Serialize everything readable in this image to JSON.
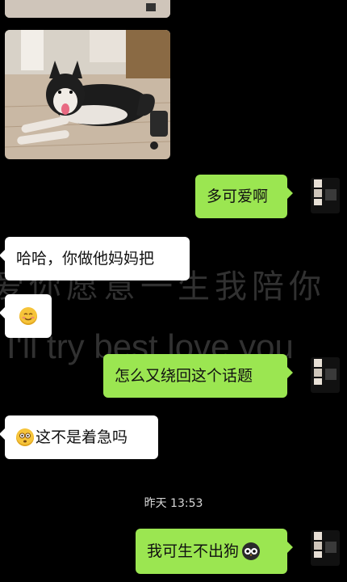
{
  "wallpaper": {
    "line1": "爱你愿意一生我陪你",
    "line2": "I'll try best love you"
  },
  "messages": [
    {
      "side": "right",
      "text": "多可爱啊"
    },
    {
      "side": "left",
      "text": "哈哈，你做他妈妈把"
    },
    {
      "side": "left",
      "emoji": "smiling-face-emoji"
    },
    {
      "side": "right",
      "text": "怎么又绕回这个话题"
    },
    {
      "side": "left",
      "text": "这不是着急吗",
      "emoji": "flushed-face-emoji"
    },
    {
      "side": "right",
      "text": "我可生不出狗",
      "emoji": "owl-face-emoji"
    }
  ],
  "timestamp": "昨天 13:53",
  "colors": {
    "sent_bubble": "#9be651",
    "received_bubble": "#ffffff",
    "background": "#000000"
  }
}
